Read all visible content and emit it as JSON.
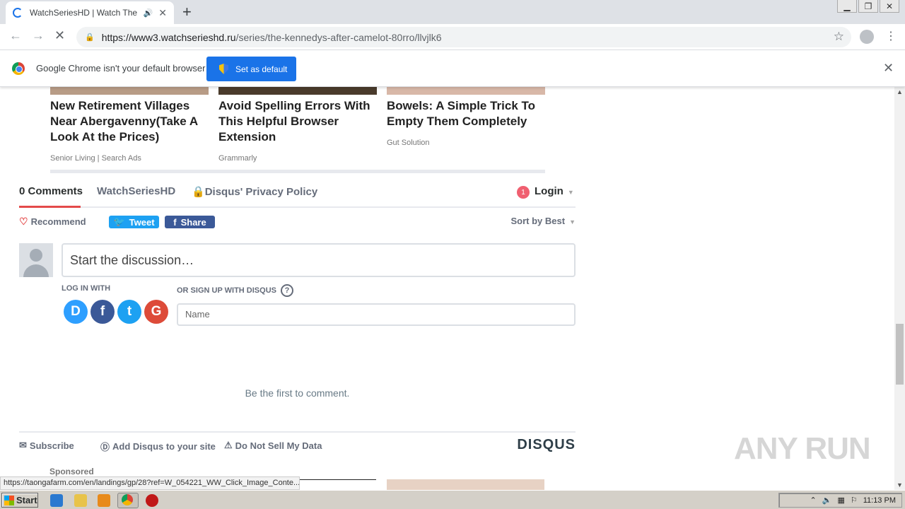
{
  "browser": {
    "tab_title": "WatchSeriesHD | Watch The Ke",
    "tab_close": "✕",
    "new_tab": "+",
    "url_host": "https://www3.watchserieshd.ru",
    "url_path": "/series/the-kennedys-after-camelot-80rro/llvjlk6"
  },
  "infobar": {
    "message": "Google Chrome isn't your default browser",
    "button": "Set as default",
    "close": "✕"
  },
  "ads_top": [
    {
      "title": "New Retirement Villages Near Abergavenny(Take A Look At the Prices)",
      "source": "Senior Living | Search Ads",
      "color": "#b89c86"
    },
    {
      "title": "Avoid Spelling Errors With This Helpful Browser Extension",
      "source": "Grammarly",
      "color": "#4a3b2c"
    },
    {
      "title": "Bowels: A Simple Trick To Empty Them Completely",
      "source": "Gut Solution",
      "color": "#d8b8a8"
    }
  ],
  "disqus": {
    "comments_tab": "0 Comments",
    "site_tab": "WatchSeriesHD",
    "privacy_tab": "Disqus' Privacy Policy",
    "notification_count": "1",
    "login": "Login",
    "recommend": "Recommend",
    "tweet": "Tweet",
    "share": "Share",
    "sort": "Sort by Best",
    "composer_placeholder": "Start the discussion…",
    "login_with": "LOG IN WITH",
    "signup_with": "OR SIGN UP WITH DISQUS",
    "help": "?",
    "name_placeholder": "Name",
    "empty": "Be the first to comment.",
    "subscribe": "Subscribe",
    "add_disqus": "Add Disqus to your site",
    "do_not_sell": "Do Not Sell My Data",
    "logo": "DISQUS",
    "social": [
      {
        "letter": "D",
        "color": "#2e9fff",
        "name": "disqus"
      },
      {
        "letter": "f",
        "color": "#3b5998",
        "name": "facebook"
      },
      {
        "letter": "t",
        "color": "#1da1f2",
        "name": "twitter"
      },
      {
        "letter": "G",
        "color": "#dd4b39",
        "name": "google"
      }
    ]
  },
  "sponsored": "Sponsored",
  "status_url": "https://taongafarm.com/en/landings/gp/28?ref=W_054221_WW_Click_Image_Conte...",
  "watermark": "ANY RUN",
  "taskbar": {
    "start": "Start",
    "clock": "11:13 PM"
  }
}
